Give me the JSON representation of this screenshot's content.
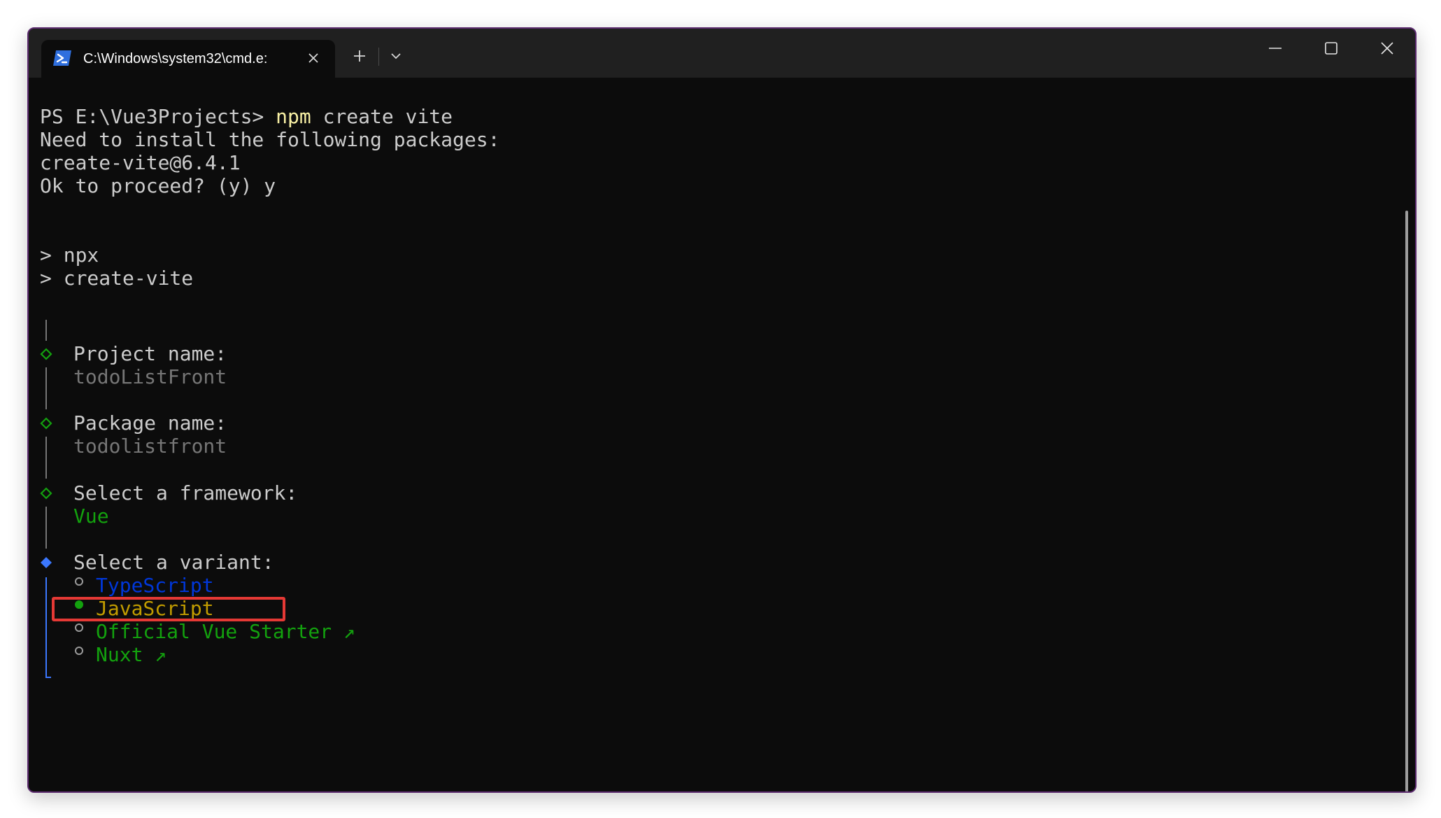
{
  "window": {
    "tab_title": "C:\\Windows\\system32\\cmd.e:",
    "icons": {
      "tab": "powershell-icon",
      "tab_close": "close-icon",
      "new_tab": "plus-icon",
      "dropdown": "chevron-down-icon",
      "minimize": "minimize-icon",
      "maximize": "maximize-icon",
      "close": "close-icon"
    }
  },
  "terminal": {
    "prompt": "PS E:\\Vue3Projects> ",
    "command": "npm",
    "command_args": " create vite",
    "install_msg": "Need to install the following packages:",
    "package": "create-vite@6.4.1",
    "proceed": "Ok to proceed? (y) y",
    "npx_line": "> npx",
    "create_vite_line": "> create-vite",
    "project_name_label": "Project name:",
    "project_name_value": "todoListFront",
    "package_name_label": "Package name:",
    "package_name_value": "todolistfront",
    "framework_label": "Select a framework:",
    "framework_value": "Vue",
    "variant_label": "Select a variant:",
    "variants": [
      {
        "label": "TypeScript",
        "selected": false
      },
      {
        "label": "JavaScript",
        "selected": true
      },
      {
        "label": "Official Vue Starter ↗",
        "selected": false
      },
      {
        "label": "Nuxt ↗",
        "selected": false
      }
    ]
  },
  "colors": {
    "background": "#0c0c0c",
    "text": "#cccccc",
    "command": "#f9f1a5",
    "dim": "#767676",
    "green": "#13a10e",
    "blue": "#0037da",
    "accent_blue": "#3b78ff",
    "yellow": "#c19c00",
    "highlight_box": "#e53935"
  }
}
